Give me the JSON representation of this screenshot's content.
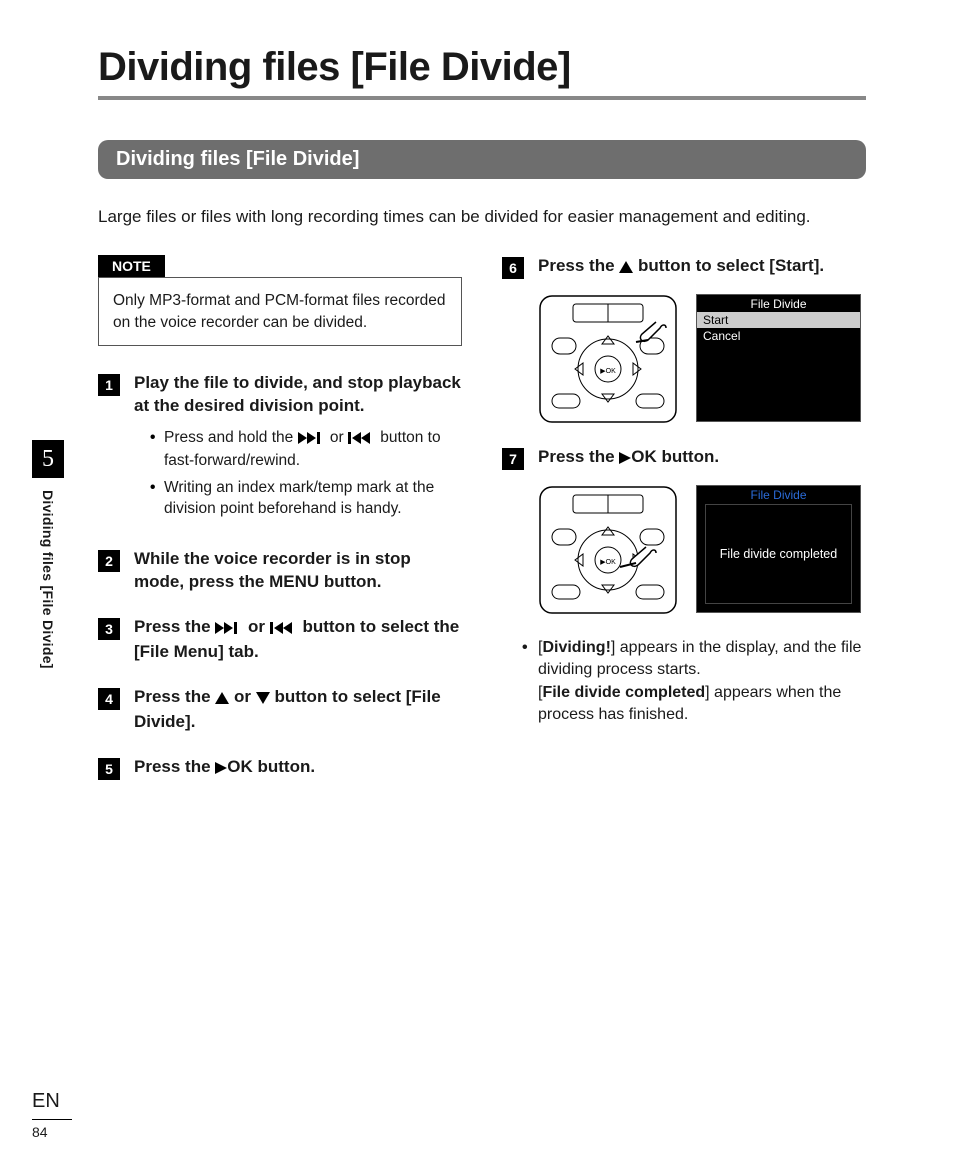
{
  "page_title": "Dividing files [File Divide]",
  "section_heading": "Dividing files [File Divide]",
  "intro": "Large files or files with long recording times can be divided for easier management and editing.",
  "note_label": "NOTE",
  "note_text": "Only MP3-format and PCM-format files recorded on the voice recorder can be divided.",
  "steps": {
    "s1": {
      "num": "1",
      "title": "Play the file to divide, and stop playback at the desired division point.",
      "b1_pre": "Press and hold the ",
      "b1_mid": " or ",
      "b1_post": " button to fast-forward/rewind.",
      "b2": "Writing an index mark/temp mark at the division point beforehand is handy."
    },
    "s2": {
      "num": "2",
      "t1": "While the voice recorder is in stop mode, press the ",
      "t_menu": "MENU",
      "t2": " button."
    },
    "s3": {
      "num": "3",
      "t1": "Press the ",
      "t_mid": " or ",
      "t2": " button to select the [",
      "t_tab": "File Menu",
      "t3": "] tab."
    },
    "s4": {
      "num": "4",
      "t1": "Press the ",
      "t_mid": " or ",
      "t2": " button to select [",
      "t_item": "File Divide",
      "t3": "]."
    },
    "s5": {
      "num": "5",
      "t1": "Press the ",
      "t_ok": "OK",
      "t2": " button."
    },
    "s6": {
      "num": "6",
      "t1": "Press the ",
      "t2": " button to select [",
      "t_item": "Start",
      "t3": "]."
    },
    "s7": {
      "num": "7",
      "t1": "Press the ",
      "t_ok": "OK",
      "t2": " button."
    }
  },
  "screen6": {
    "title": "File Divide",
    "opt1": "Start",
    "opt2": "Cancel"
  },
  "screen7": {
    "title": "File Divide",
    "msg": "File divide completed"
  },
  "result": {
    "r1a": "[",
    "r1b": "Dividing!",
    "r1c": "] appears in the display, and the file dividing process starts.",
    "r2a": "[",
    "r2b": "File divide completed",
    "r2c": "] appears when the process has finished."
  },
  "sidebar": {
    "chapter": "5",
    "label": "Dividing files [File Divide]"
  },
  "footer": {
    "lang": "EN",
    "page": "84"
  }
}
